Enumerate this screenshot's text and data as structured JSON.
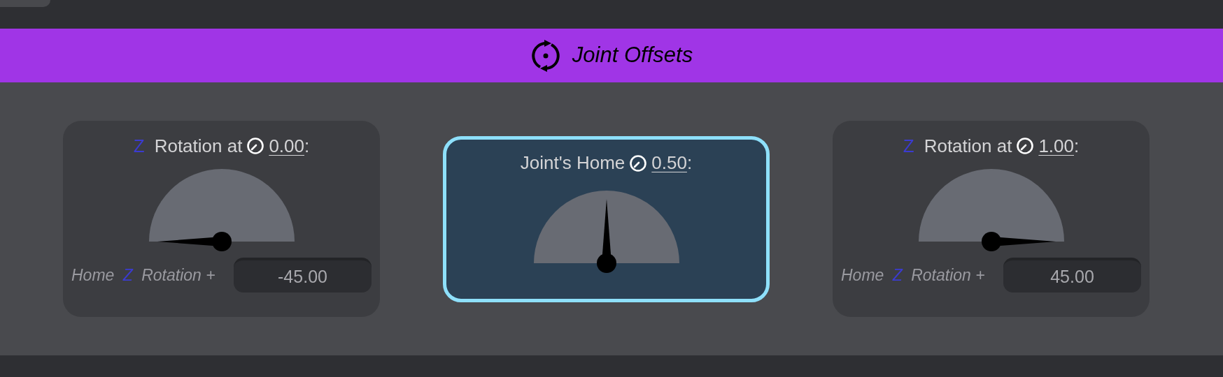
{
  "header": {
    "title": "Joint Offsets"
  },
  "cards": [
    {
      "kind": "keyframe",
      "selected": false,
      "axis": "Z",
      "label": "Rotation at",
      "time": "0.00",
      "suffix": ":",
      "offset": {
        "prefix": "Home",
        "axis": "Z",
        "label": "Rotation +",
        "value": "-45.00"
      }
    },
    {
      "kind": "home",
      "selected": true,
      "label": "Joint's Home",
      "time": "0.50",
      "suffix": ":"
    },
    {
      "kind": "keyframe",
      "selected": false,
      "axis": "Z",
      "label": "Rotation at",
      "time": "1.00",
      "suffix": ":",
      "offset": {
        "prefix": "Home",
        "axis": "Z",
        "label": "Rotation +",
        "value": "45.00"
      }
    }
  ]
}
